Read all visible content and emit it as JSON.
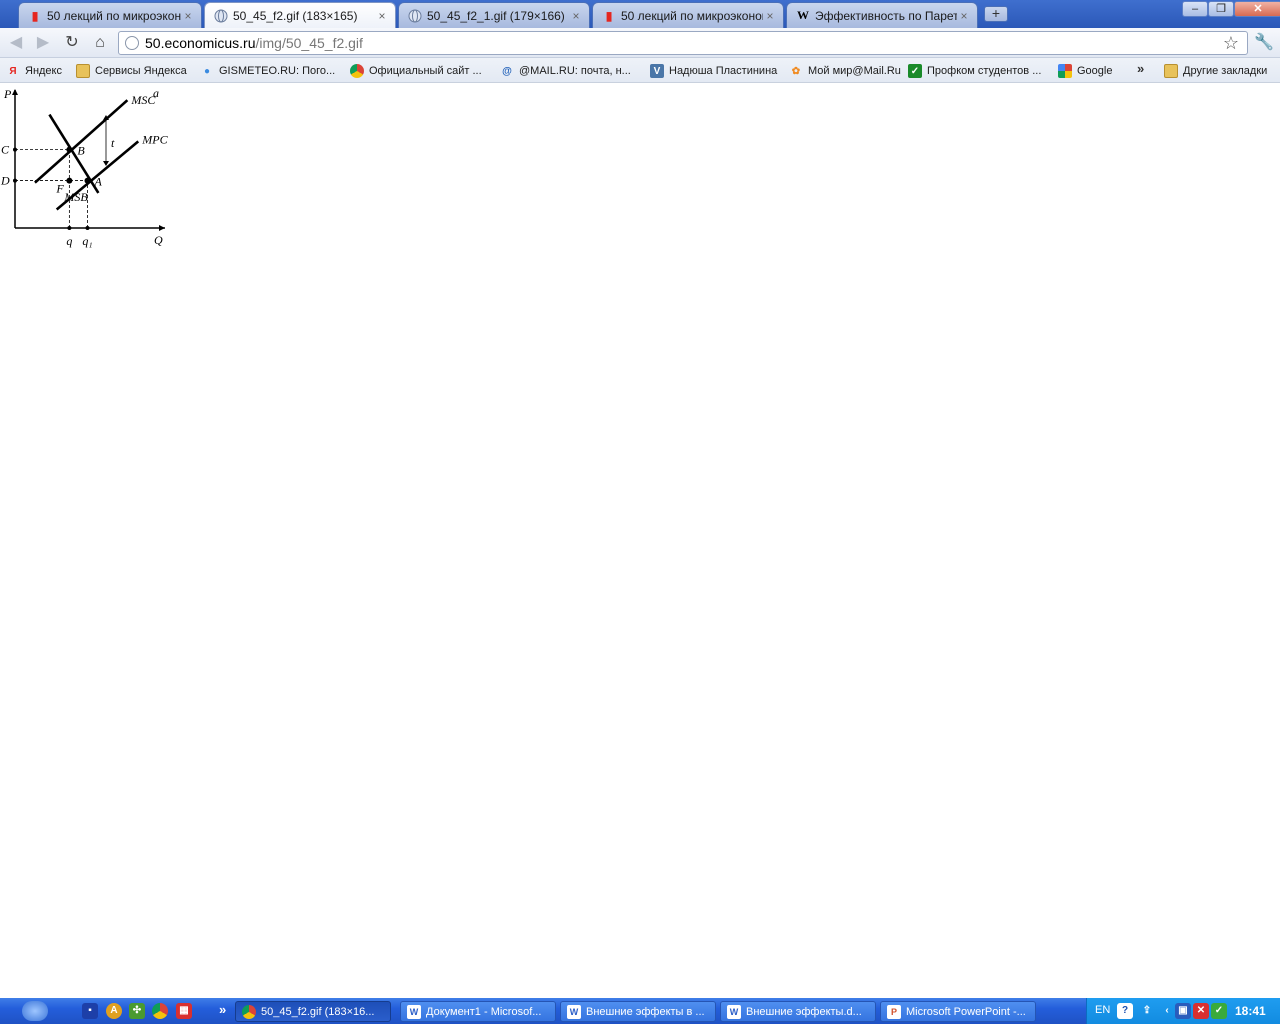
{
  "browser": {
    "tabs": [
      {
        "title": "50 лекций по микроэкономик",
        "icon": "red-book-icon",
        "active": false
      },
      {
        "title": "50_45_f2.gif (183×165)",
        "icon": "globe-icon",
        "active": true
      },
      {
        "title": "50_45_f2_1.gif (179×166)",
        "icon": "globe-icon",
        "active": false
      },
      {
        "title": "50 лекций по микроэкономик",
        "icon": "red-book-icon",
        "active": false
      },
      {
        "title": "Эффективность по Парето -",
        "icon": "wikipedia-icon",
        "active": false
      }
    ],
    "tab_close_glyph": "×",
    "new_tab_glyph": "+",
    "window_controls": {
      "minimize": "–",
      "maximize": "❐",
      "close": "✕"
    },
    "url": {
      "host": "50.economicus.ru",
      "path": "/img/50_45_f2.gif"
    },
    "bookmarks": [
      {
        "label": "Яндекс",
        "icon": "yandex-icon",
        "color": "#e52620"
      },
      {
        "label": "Сервисы Яндекса",
        "icon": "folder-icon",
        "color": "#e8c25a"
      },
      {
        "label": "GISMETEO.RU: Пого...",
        "icon": "weather-drop-icon",
        "color": "#3b8be0"
      },
      {
        "label": "Официальный сайт ...",
        "icon": "chrome-icon",
        "color": "#e8a020"
      },
      {
        "label": "@MAIL.RU: почта, н...",
        "icon": "mail-ru-icon",
        "color": "#1f5fb8"
      },
      {
        "label": "Надюша Пластинина",
        "icon": "vkontakte-icon",
        "color": "#4a76a8"
      },
      {
        "label": "Мой мир@Mail.Ru",
        "icon": "moy-mir-icon",
        "color": "#f08a20"
      },
      {
        "label": "Профком студентов ...",
        "icon": "checkbox-icon",
        "color": "#1a8a2a"
      },
      {
        "label": "Google",
        "icon": "google-icon",
        "color": "#3b78e7"
      },
      {
        "label": "Другие закладки",
        "icon": "folder-icon",
        "color": "#e8c25a"
      }
    ],
    "bookmarks_more_glyph": "»"
  },
  "chart_data": {
    "type": "line",
    "panel_label": "a",
    "xlabel": "Q",
    "ylabel": "P",
    "series": [
      {
        "name": "MSC",
        "x": [
          1.1,
          6.2
        ],
        "y": [
          2.2,
          6.2
        ]
      },
      {
        "name": "MPC",
        "x": [
          2.3,
          6.8
        ],
        "y": [
          0.9,
          4.2
        ]
      },
      {
        "name": "MSB",
        "x": [
          1.9,
          4.6
        ],
        "y": [
          5.5,
          1.7
        ]
      }
    ],
    "points": [
      {
        "label": "B",
        "x": 3.0,
        "y": 3.8
      },
      {
        "label": "A",
        "x": 4.0,
        "y": 2.3
      },
      {
        "label": "F",
        "x": 3.0,
        "y": 2.3
      }
    ],
    "y_ticks": [
      {
        "label": "C",
        "y": 3.8
      },
      {
        "label": "D",
        "y": 2.3
      }
    ],
    "x_ticks": [
      {
        "label": "q",
        "x": 3.0
      },
      {
        "label": "q₁",
        "x": 4.0
      }
    ],
    "annotation": "t",
    "xlim": [
      0,
      8
    ],
    "ylim": [
      0,
      6.5
    ]
  },
  "taskbar": {
    "quick_launch": [
      {
        "icon": "save-disk-icon",
        "color": "#1d3fa8"
      },
      {
        "icon": "warning-icon",
        "color": "#e0a020"
      },
      {
        "icon": "network-icon",
        "color": "#4a9a30"
      },
      {
        "icon": "chrome-icon",
        "color": "#e0a020"
      },
      {
        "icon": "calendar-icon",
        "color": "#d83030"
      }
    ],
    "quick_launch_more": "»",
    "tasks": [
      {
        "label": "50_45_f2.gif (183×16...",
        "icon": "chrome-icon",
        "color": "#e8a020",
        "active": true
      },
      {
        "label": "Документ1 - Microsof...",
        "icon": "word-icon",
        "color": "#2c5ec8",
        "active": false
      },
      {
        "label": "Внешние эффекты в ...",
        "icon": "word-icon",
        "color": "#2c5ec8",
        "active": false
      },
      {
        "label": "Внешние эффекты.d...",
        "icon": "word-icon",
        "color": "#2c5ec8",
        "active": false
      },
      {
        "label": "Microsoft PowerPoint -...",
        "icon": "powerpoint-icon",
        "color": "#d2502a",
        "active": false
      }
    ],
    "tray": {
      "language": "EN",
      "clock": "18:41",
      "icons": [
        {
          "icon": "help-icon",
          "color": "#ffffff"
        },
        {
          "icon": "usb-icon",
          "color": "#3a6fd0"
        },
        {
          "icon": "tray-chevron-icon",
          "color": "#1a8ae0"
        },
        {
          "icon": "network-monitor-icon",
          "color": "#2a5cbc"
        },
        {
          "icon": "antivirus-icon",
          "color": "#d83030"
        },
        {
          "icon": "shield-check-icon",
          "color": "#3aaa3a"
        }
      ]
    }
  }
}
